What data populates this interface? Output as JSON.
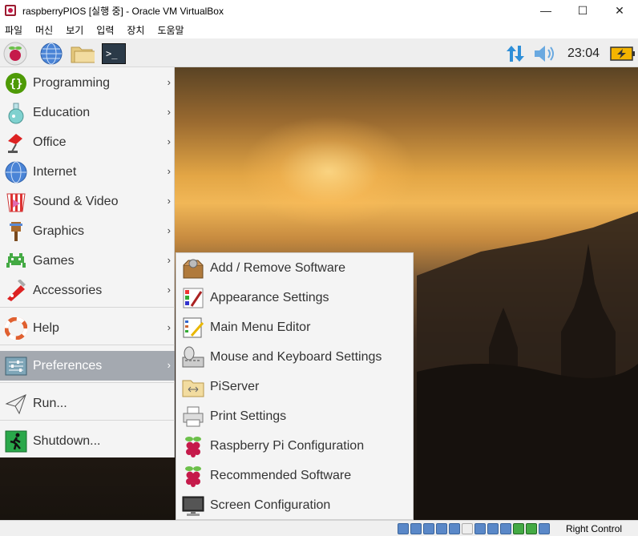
{
  "window": {
    "title": "raspberryPIOS [실행 중] - Oracle VM VirtualBox",
    "minimize_glyph": "—",
    "maximize_glyph": "☐",
    "close_glyph": "✕"
  },
  "menubar": {
    "items": [
      {
        "label": "파일"
      },
      {
        "label": "머신"
      },
      {
        "label": "보기"
      },
      {
        "label": "입력"
      },
      {
        "label": "장치"
      },
      {
        "label": "도움말"
      }
    ]
  },
  "panel": {
    "clock": "23:04",
    "terminal_glyph": ">_"
  },
  "main_menu": {
    "arrow": "›",
    "items": [
      {
        "label": "Programming",
        "icon": "programming-icon"
      },
      {
        "label": "Education",
        "icon": "education-icon"
      },
      {
        "label": "Office",
        "icon": "office-icon"
      },
      {
        "label": "Internet",
        "icon": "internet-icon"
      },
      {
        "label": "Sound & Video",
        "icon": "sound-video-icon"
      },
      {
        "label": "Graphics",
        "icon": "graphics-icon"
      },
      {
        "label": "Games",
        "icon": "games-icon"
      },
      {
        "label": "Accessories",
        "icon": "accessories-icon"
      },
      {
        "label": "Help",
        "icon": "help-icon"
      },
      {
        "label": "Preferences",
        "icon": "preferences-icon",
        "active": true
      },
      {
        "label": "Run...",
        "icon": "run-icon"
      },
      {
        "label": "Shutdown...",
        "icon": "shutdown-icon"
      }
    ]
  },
  "preferences_submenu": {
    "items": [
      {
        "label": "Add / Remove Software",
        "icon": "package-icon"
      },
      {
        "label": "Appearance Settings",
        "icon": "appearance-icon"
      },
      {
        "label": "Main Menu Editor",
        "icon": "menu-editor-icon"
      },
      {
        "label": "Mouse and Keyboard Settings",
        "icon": "mouse-keyboard-icon"
      },
      {
        "label": "PiServer",
        "icon": "piserver-icon"
      },
      {
        "label": "Print Settings",
        "icon": "printer-icon"
      },
      {
        "label": "Raspberry Pi Configuration",
        "icon": "raspberry-icon"
      },
      {
        "label": "Recommended Software",
        "icon": "raspberry-icon"
      },
      {
        "label": "Screen Configuration",
        "icon": "monitor-icon"
      }
    ]
  },
  "statusbar": {
    "host_key": "Right Control"
  },
  "colors": {
    "menu_bg": "#f4f4f4",
    "active_item": "#a4a9b0",
    "raspberry_red": "#c51a4a",
    "leaf_green": "#6cc04a"
  }
}
